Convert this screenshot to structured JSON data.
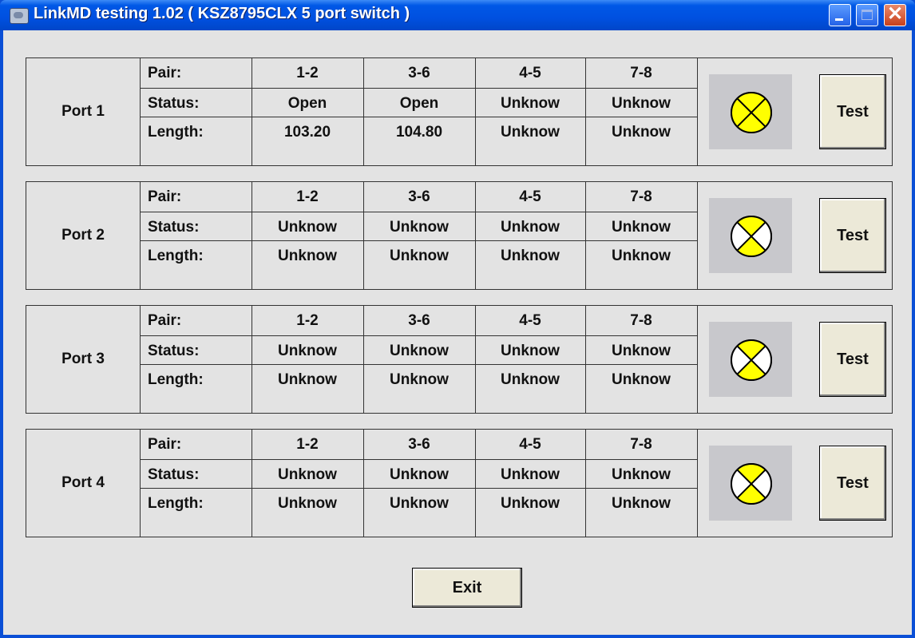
{
  "window": {
    "title": "LinkMD testing 1.02 ( KSZ8795CLX 5 port switch )"
  },
  "row_labels": {
    "pair": "Pair:",
    "status": "Status:",
    "length": "Length:"
  },
  "pair_headers": [
    "1-2",
    "3-6",
    "4-5",
    "7-8"
  ],
  "ports": [
    {
      "label": "Port 1",
      "status": [
        "Open",
        "Open",
        "Unknow",
        "Unknow"
      ],
      "length": [
        "103.20",
        "104.80",
        "Unknow",
        "Unknow"
      ],
      "test_label": "Test",
      "indicator": "status-indicator-icon"
    },
    {
      "label": "Port 2",
      "status": [
        "Unknow",
        "Unknow",
        "Unknow",
        "Unknow"
      ],
      "length": [
        "Unknow",
        "Unknow",
        "Unknow",
        "Unknow"
      ],
      "test_label": "Test",
      "indicator": "status-indicator-icon"
    },
    {
      "label": "Port 3",
      "status": [
        "Unknow",
        "Unknow",
        "Unknow",
        "Unknow"
      ],
      "length": [
        "Unknow",
        "Unknow",
        "Unknow",
        "Unknow"
      ],
      "test_label": "Test",
      "indicator": "status-indicator-icon"
    },
    {
      "label": "Port 4",
      "status": [
        "Unknow",
        "Unknow",
        "Unknow",
        "Unknow"
      ],
      "length": [
        "Unknow",
        "Unknow",
        "Unknow",
        "Unknow"
      ],
      "test_label": "Test",
      "indicator": "status-indicator-icon"
    }
  ],
  "exit_label": "Exit",
  "colors": {
    "indicator_yellow": "#FFFF00",
    "titlebar": "#0058E6",
    "client_bg": "#E3E3E3"
  }
}
